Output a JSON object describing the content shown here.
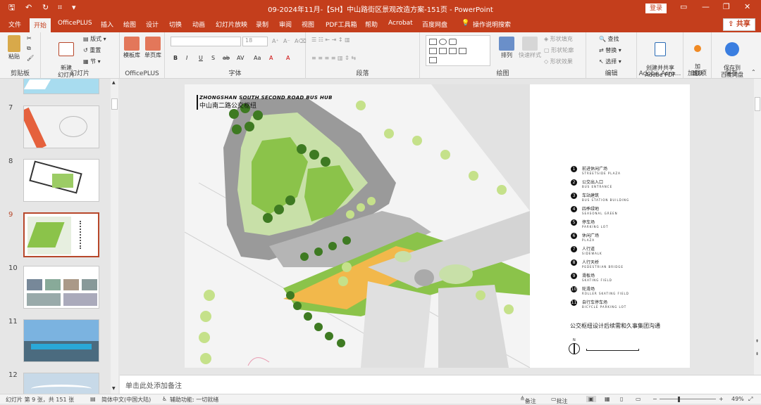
{
  "window": {
    "title": "09-2024年11月-【SH】中山路街区景观改造方案-151页 - PowerPoint",
    "login": "登录",
    "share": "共享"
  },
  "tabs": [
    "文件",
    "开始",
    "OfficePLUS",
    "插入",
    "绘图",
    "设计",
    "切换",
    "动画",
    "幻灯片放映",
    "录制",
    "审阅",
    "视图",
    "PDF工具箱",
    "帮助",
    "Acrobat",
    "百度网盘",
    "操作说明搜索"
  ],
  "active_tab": "开始",
  "ribbon": {
    "clipboard": {
      "paste": "粘贴",
      "label": "剪贴板"
    },
    "slides": {
      "new_slide": "新建\n幻灯片",
      "layout": "版式",
      "reset": "重置",
      "section": "节",
      "label": "幻灯片"
    },
    "officeplus": {
      "template": "模板库",
      "single": "单页库",
      "label": "OfficePLUS"
    },
    "font": {
      "size": "18",
      "label": "字体",
      "buttons": [
        "B",
        "I",
        "U",
        "S",
        "ab",
        "AV",
        "Aa",
        "A",
        "A"
      ]
    },
    "paragraph": {
      "label": "段落"
    },
    "drawing": {
      "arrange": "排列",
      "quick_styles": "快速样式",
      "fill": "形状填充",
      "outline": "形状轮廓",
      "effects": "形状效果",
      "label": "绘图"
    },
    "editing": {
      "find": "查找",
      "replace": "替换",
      "select": "选择",
      "label": "编辑"
    },
    "adobe": {
      "create": "创建并共享\nAdobe PDF",
      "label": "Adobe Acro..."
    },
    "addins": {
      "add": "加\n载项",
      "label": "加载项"
    },
    "save": {
      "save_baidu": "保存到\n百度网盘",
      "label": "保存"
    }
  },
  "thumbnails": [
    {
      "num": "7"
    },
    {
      "num": "8"
    },
    {
      "num": "9"
    },
    {
      "num": "10"
    },
    {
      "num": "11"
    },
    {
      "num": "12"
    }
  ],
  "slide": {
    "title_en": "ZHONGSHAN SOUTH SECOND ROAD BUS HUB",
    "title_cn": "中山南二路公交枢纽",
    "legend": [
      {
        "n": "1",
        "cn": "前进休闲广场",
        "en": "STREETSIDE PLAZA"
      },
      {
        "n": "2",
        "cn": "公交出入口",
        "en": "BUS ENTRANCE"
      },
      {
        "n": "3",
        "cn": "车站建筑",
        "en": "BUS STATION BUILDING"
      },
      {
        "n": "4",
        "cn": "四季绿地",
        "en": "SEASONAL GREEN"
      },
      {
        "n": "5",
        "cn": "停车场",
        "en": "PARKING LOT"
      },
      {
        "n": "6",
        "cn": "休闲广场",
        "en": "PLAZA"
      },
      {
        "n": "7",
        "cn": "人行道",
        "en": "SIDEWALK"
      },
      {
        "n": "8",
        "cn": "人行天桥",
        "en": "PEDESTRIAN BRIDGE"
      },
      {
        "n": "9",
        "cn": "滑板场",
        "en": "SKATING FIELD"
      },
      {
        "n": "10",
        "cn": "轮滑场",
        "en": "ROLLER SKATING FIELD"
      },
      {
        "n": "11",
        "cn": "自行车停车场",
        "en": "BICYCLE PARKING LOT"
      }
    ],
    "caption": "公交枢纽设计后续需和久事集团沟通",
    "north": "N"
  },
  "notes_placeholder": "单击此处添加备注",
  "status": {
    "slide_info": "幻灯片 第 9 张，共 151 张",
    "language": "简体中文(中国大陆)",
    "accessibility": "辅助功能: 一切就绪",
    "notes": "备注",
    "comments": "批注",
    "zoom": "49%"
  },
  "colors": {
    "accent": "#c43e1c",
    "selected_thumb": "#b7472a"
  }
}
